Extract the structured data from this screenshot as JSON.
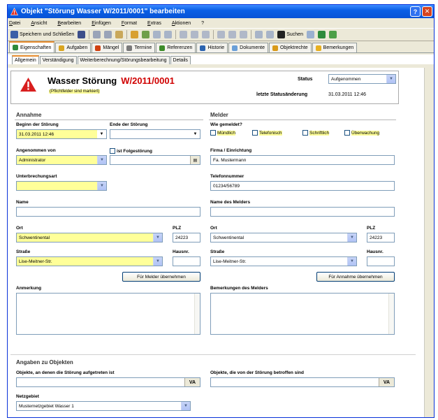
{
  "window": {
    "title": "Objekt \"Störung Wasser W/2011/0001\" bearbeiten",
    "help_label": "?",
    "close_label": "✕"
  },
  "menu": [
    "Datei",
    "Ansicht",
    "Bearbeiten",
    "Einfügen",
    "Format",
    "Extras",
    "Aktionen",
    "?"
  ],
  "toolbar": {
    "save_close": "Speichern und Schließen",
    "search": "Suchen"
  },
  "tabs": [
    {
      "label": "Eigenschaften",
      "color": "#2e8b3c"
    },
    {
      "label": "Aufgaben",
      "color": "#d9a520"
    },
    {
      "label": "Mängel",
      "color": "#d04010"
    },
    {
      "label": "Termine",
      "color": "#7a7a7a"
    },
    {
      "label": "Referenzen",
      "color": "#3d8c2a"
    },
    {
      "label": "Historie",
      "color": "#2c64b0"
    },
    {
      "label": "Dokumente",
      "color": "#6a9fd8"
    },
    {
      "label": "Objektrechte",
      "color": "#d99a1a"
    },
    {
      "label": "Bemerkungen",
      "color": "#e8b020"
    }
  ],
  "subtabs": [
    "Allgemein",
    "Verständigung",
    "Weiterberechnung/Störungsbearbeitung",
    "Details"
  ],
  "header": {
    "title": "Wasser Störung",
    "number": "W/2011/0001",
    "required_hint": "(Pflichtfelder sind markiert)",
    "status_label": "Status",
    "status_value": "Aufgenommen",
    "last_change_label": "letzte Statusänderung",
    "last_change_value": "31.03.2011 12:46"
  },
  "annahme": {
    "title": "Annahme",
    "begin_label": "Beginn der Störung",
    "begin_value": "31.03.2011 12:46",
    "end_label": "Ende der Störung",
    "end_value": "",
    "accepted_label": "Angenommen von",
    "accepted_value": "Administrator",
    "folge_label": "ist Folgestörung",
    "interruption_label": "Unterbrechungsart",
    "interruption_value": "",
    "name_label": "Name",
    "name_value": "",
    "city_label": "Ort",
    "city_value": "Schwentinental",
    "zip_label": "PLZ",
    "zip_value": "24223",
    "street_label": "Straße",
    "street_value": "Lise-Meitner-Str.",
    "houseno_label": "Hausnr.",
    "houseno_value": "",
    "copy_button": "Für Melder übernehmen",
    "remark_label": "Anmerkung"
  },
  "melder": {
    "title": "Melder",
    "how_label": "Wie gemeldet?",
    "options": [
      "Mündlich",
      "Telefonisch",
      "Schriftlich",
      "Überwachung"
    ],
    "company_label": "Firma / Einrichtung",
    "company_value": "Fa. Mustermann",
    "phone_label": "Telefonnummer",
    "phone_value": "01234/56789",
    "reporter_label": "Name des Melders",
    "reporter_value": "",
    "city_label": "Ort",
    "city_value": "Schwentinental",
    "zip_label": "PLZ",
    "zip_value": "24223",
    "street_label": "Straße",
    "street_value": "Lise-Meitner-Str.",
    "houseno_label": "Hausnr.",
    "houseno_value": "",
    "copy_button": "Für Annahme übernehmen",
    "remark_label": "Bemerkungen des Melders"
  },
  "objects": {
    "title": "Angaben zu Objekten",
    "affected_label": "Objekte, an denen die Störung aufgetreten ist",
    "affected_value": "",
    "impacted_label": "Objekte, die von der Störung betroffen sind",
    "impacted_value": "",
    "va_label": "VA",
    "network_label": "Netzgebiet",
    "network_value": "Musternetzgebiet Wasser 1"
  },
  "colors": {
    "required": "#ffff99",
    "title_red": "#d00000",
    "titlebar": "#0a5fe6"
  }
}
